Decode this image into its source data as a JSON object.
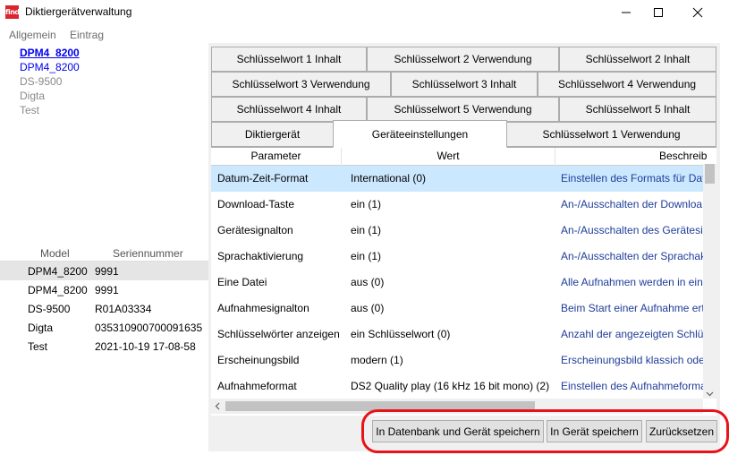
{
  "window": {
    "icon_text": "find",
    "title": "Diktiergerätverwaltung"
  },
  "menu": {
    "items": [
      "Allgemein",
      "Eintrag"
    ]
  },
  "device_list": {
    "items": [
      "DPM4_8200",
      "DPM4_8200",
      "DS-9500",
      "Digta",
      "Test"
    ]
  },
  "serial_table": {
    "headers": [
      "Model",
      "Seriennummer"
    ],
    "rows": [
      {
        "model": "DPM4_8200",
        "serial": "9991"
      },
      {
        "model": "DPM4_8200",
        "serial": "9991"
      },
      {
        "model": "DS-9500",
        "serial": "R01A03334"
      },
      {
        "model": "Digta",
        "serial": "035310900700091635"
      },
      {
        "model": "Test",
        "serial": "2021-10-19 17-08-58"
      }
    ]
  },
  "tabs": {
    "row1": [
      "Schlüsselwort 1 Inhalt",
      "Schlüsselwort 2 Verwendung",
      "Schlüsselwort 2 Inhalt"
    ],
    "row2": [
      "Schlüsselwort 3 Verwendung",
      "Schlüsselwort 3 Inhalt",
      "Schlüsselwort 4 Verwendung"
    ],
    "row3": [
      "Schlüsselwort 4 Inhalt",
      "Schlüsselwort 5 Verwendung",
      "Schlüsselwort 5 Inhalt"
    ],
    "row4": [
      "Diktiergerät",
      "Geräteeinstellungen",
      "Schlüsselwort 1 Verwendung"
    ],
    "active": "Geräteeinstellungen"
  },
  "grid": {
    "headers": [
      "Parameter",
      "Wert",
      "Beschreib"
    ],
    "rows": [
      {
        "param": "Datum-Zeit-Format",
        "value": "International (0)",
        "desc": "Einstellen des Formats für Dat"
      },
      {
        "param": "Download-Taste",
        "value": "ein (1)",
        "desc": "An-/Ausschalten der Downloa"
      },
      {
        "param": "Gerätesignalton",
        "value": "ein (1)",
        "desc": "An-/Ausschalten des Gerätesig"
      },
      {
        "param": "Sprachaktivierung",
        "value": "ein (1)",
        "desc": "An-/Ausschalten der Sprachak"
      },
      {
        "param": "Eine Datei",
        "value": "aus (0)",
        "desc": "Alle Aufnahmen werden in ein"
      },
      {
        "param": "Aufnahmesignalton",
        "value": "aus (0)",
        "desc": "Beim Start einer Aufnahme ert"
      },
      {
        "param": "Schlüsselwörter anzeigen",
        "value": "ein Schlüsselwort (0)",
        "desc": "Anzahl der angezeigten Schlüs"
      },
      {
        "param": "Erscheinungsbild",
        "value": "modern (1)",
        "desc": "Erscheinungsbild klassich oder"
      },
      {
        "param": "Aufnahmeformat",
        "value": "DS2 Quality play (16 kHz 16 bit mono) (2)",
        "desc": "Einstellen des Aufnahmeforma"
      }
    ]
  },
  "buttons": {
    "save_db_device": "In Datenbank und Gerät speichern",
    "save_device": "In Gerät speichern",
    "reset": "Zurücksetzen"
  },
  "colors": {
    "selection": "#cce8ff",
    "link": "#0000ee",
    "description_text": "#1f3d99",
    "highlight_oval": "#e8121a",
    "app_icon": "#d9262d"
  }
}
